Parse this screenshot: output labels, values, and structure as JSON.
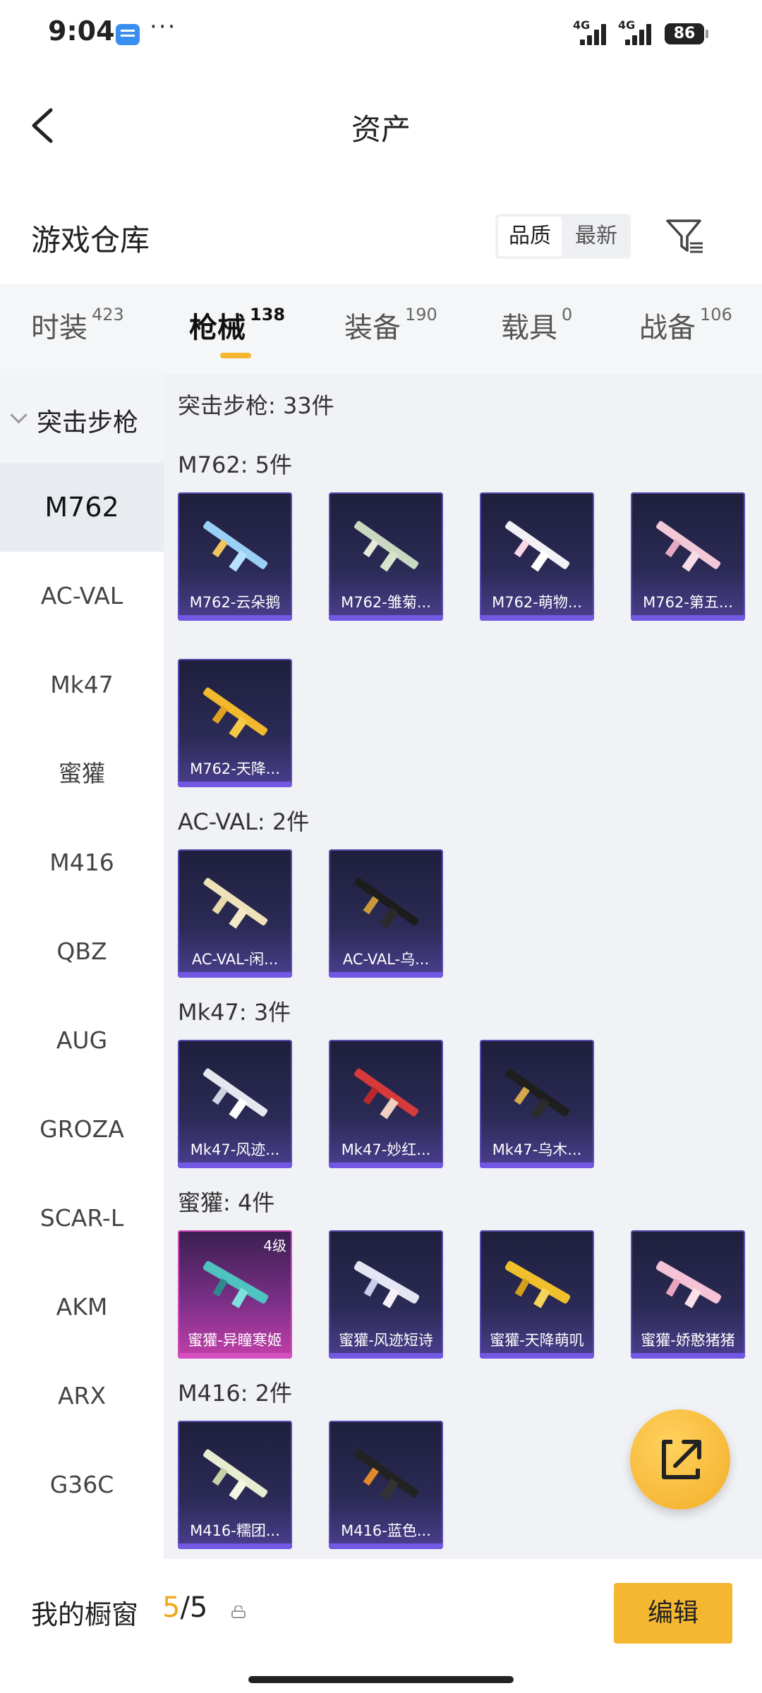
{
  "status": {
    "time": "9:04",
    "network1": "4G",
    "network2": "4G",
    "battery": "86"
  },
  "nav": {
    "title": "资产"
  },
  "header": {
    "title": "游戏仓库",
    "sort_options": [
      "品质",
      "最新"
    ],
    "active_sort": "品质"
  },
  "tabs": [
    {
      "label": "时装",
      "count": "423"
    },
    {
      "label": "枪械",
      "count": "138",
      "active": true
    },
    {
      "label": "装备",
      "count": "190"
    },
    {
      "label": "载具",
      "count": "0"
    },
    {
      "label": "战备",
      "count": "106"
    }
  ],
  "sidebar": {
    "group": "突击步枪",
    "items": [
      "M762",
      "AC-VAL",
      "Mk47",
      "蜜獾",
      "M416",
      "QBZ",
      "AUG",
      "GROZA",
      "SCAR-L",
      "AKM",
      "ARX",
      "G36C"
    ],
    "active": "M762"
  },
  "content": {
    "category_title": "突击步枪: 33件",
    "sections": [
      {
        "title": "M762: 5件",
        "items": [
          "M762-云朵鹅",
          "M762-雏菊...",
          "M762-萌物...",
          "M762-第五...",
          "M762-天降..."
        ]
      },
      {
        "title": "AC-VAL: 2件",
        "items": [
          "AC-VAL-闲...",
          "AC-VAL-乌..."
        ]
      },
      {
        "title": "Mk47: 3件",
        "items": [
          "Mk47-风迹...",
          "Mk47-妙红...",
          "Mk47-乌木..."
        ]
      },
      {
        "title": "蜜獾: 4件",
        "items": [
          "蜜獾-异瞳寒姬",
          "蜜獾-风迹短诗",
          "蜜獾-天降萌叽",
          "蜜獾-娇憨猪猪"
        ],
        "level_badge": "4级"
      },
      {
        "title": "M416: 2件",
        "items": [
          "M416-糯团...",
          "M416-蓝色..."
        ]
      }
    ]
  },
  "bottom": {
    "label": "我的橱窗",
    "current": "5",
    "total": "/5",
    "edit_label": "编辑"
  },
  "colors": {
    "accent": "#f5b731",
    "card_dark": "#2b2a55",
    "card_purple": "#c33fa9"
  }
}
